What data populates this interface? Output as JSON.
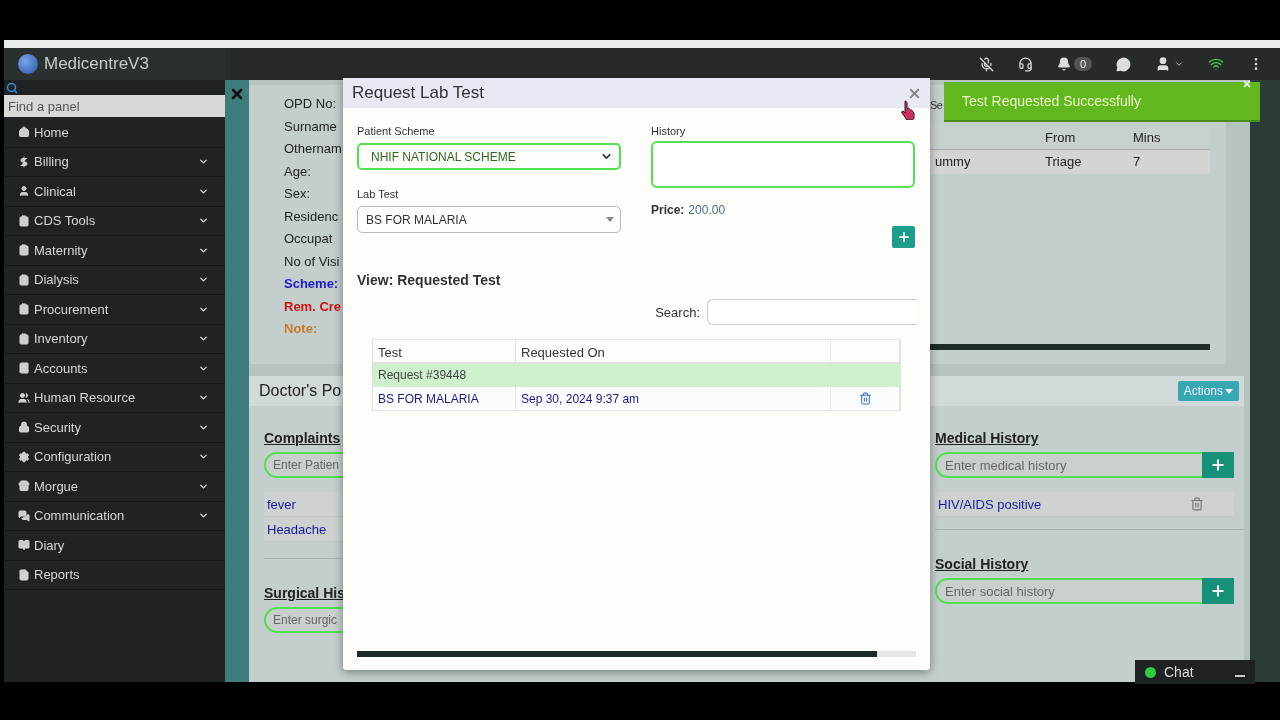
{
  "app": {
    "title": "MedicentreV3"
  },
  "header": {
    "notification_count": "0"
  },
  "sidebar": {
    "search_placeholder": "Find a panel",
    "items": [
      {
        "label": "Home",
        "has_submenu": false
      },
      {
        "label": "Billing",
        "has_submenu": true
      },
      {
        "label": "Clinical",
        "has_submenu": true
      },
      {
        "label": "CDS Tools",
        "has_submenu": true
      },
      {
        "label": "Maternity",
        "has_submenu": true
      },
      {
        "label": "Dialysis",
        "has_submenu": true
      },
      {
        "label": "Procurement",
        "has_submenu": true
      },
      {
        "label": "Inventory",
        "has_submenu": true
      },
      {
        "label": "Accounts",
        "has_submenu": true
      },
      {
        "label": "Human Resource",
        "has_submenu": true
      },
      {
        "label": "Security",
        "has_submenu": true
      },
      {
        "label": "Configuration",
        "has_submenu": true
      },
      {
        "label": "Morgue",
        "has_submenu": true
      },
      {
        "label": "Communication",
        "has_submenu": true
      },
      {
        "label": "Diary",
        "has_submenu": false
      },
      {
        "label": "Reports",
        "has_submenu": false
      }
    ]
  },
  "patient_details": {
    "fields": [
      {
        "label": "OPD No:",
        "color": "#222222"
      },
      {
        "label": "Surname",
        "color": "#222222"
      },
      {
        "label": "Othernam",
        "color": "#222222"
      },
      {
        "label": "Age:",
        "color": "#222222"
      },
      {
        "label": "Sex:",
        "color": "#222222"
      },
      {
        "label": "Residenc",
        "color": "#222222"
      },
      {
        "label": "Occupat",
        "color": "#222222"
      },
      {
        "label": "No of Visi",
        "color": "#222222"
      },
      {
        "label": "Scheme:",
        "color": "#1a1acc"
      },
      {
        "label": "Rem. Cre",
        "color": "#cc1111"
      },
      {
        "label": "Note:",
        "color": "#c77a2a"
      }
    ],
    "side_label": "Se",
    "queue_table": {
      "columns": [
        "",
        "From",
        "Mins"
      ],
      "rows": [
        [
          "ummy",
          "Triage",
          "7"
        ]
      ]
    }
  },
  "doctors_panel": {
    "title": "Doctor's Po",
    "actions": "Actions",
    "left_sections": [
      {
        "title": "Complaints",
        "placeholder": "Enter Patien",
        "items": [
          "fever",
          "Headache"
        ]
      },
      {
        "title": "Surgical His",
        "placeholder": "Enter surgic"
      }
    ],
    "right_sections": [
      {
        "title": "Medical History",
        "placeholder": "Enter medical history",
        "items": [
          "HIV/AIDS positive"
        ]
      },
      {
        "title": "Social History",
        "placeholder": "Enter social history"
      }
    ]
  },
  "modal": {
    "title": "Request Lab Test",
    "scheme_label": "Patient Scheme",
    "scheme_value": "NHIF NATIONAL SCHEME",
    "history_label": "History",
    "lab_test_label": "Lab Test",
    "lab_test_value": "BS FOR MALARIA",
    "price_label": "Price:",
    "price_value": "200.00",
    "section_title": "View: Requested Test",
    "search_label": "Search:",
    "table": {
      "columns": [
        "Test",
        "Requested On"
      ],
      "groups": [
        {
          "title": "Request #39448",
          "rows": [
            {
              "test": "BS FOR MALARIA",
              "requested_on": "Sep 30, 2024 9:37 am"
            }
          ]
        }
      ]
    }
  },
  "toast": {
    "message": "Test Requested Successfully"
  },
  "chat": {
    "label": "Chat"
  }
}
